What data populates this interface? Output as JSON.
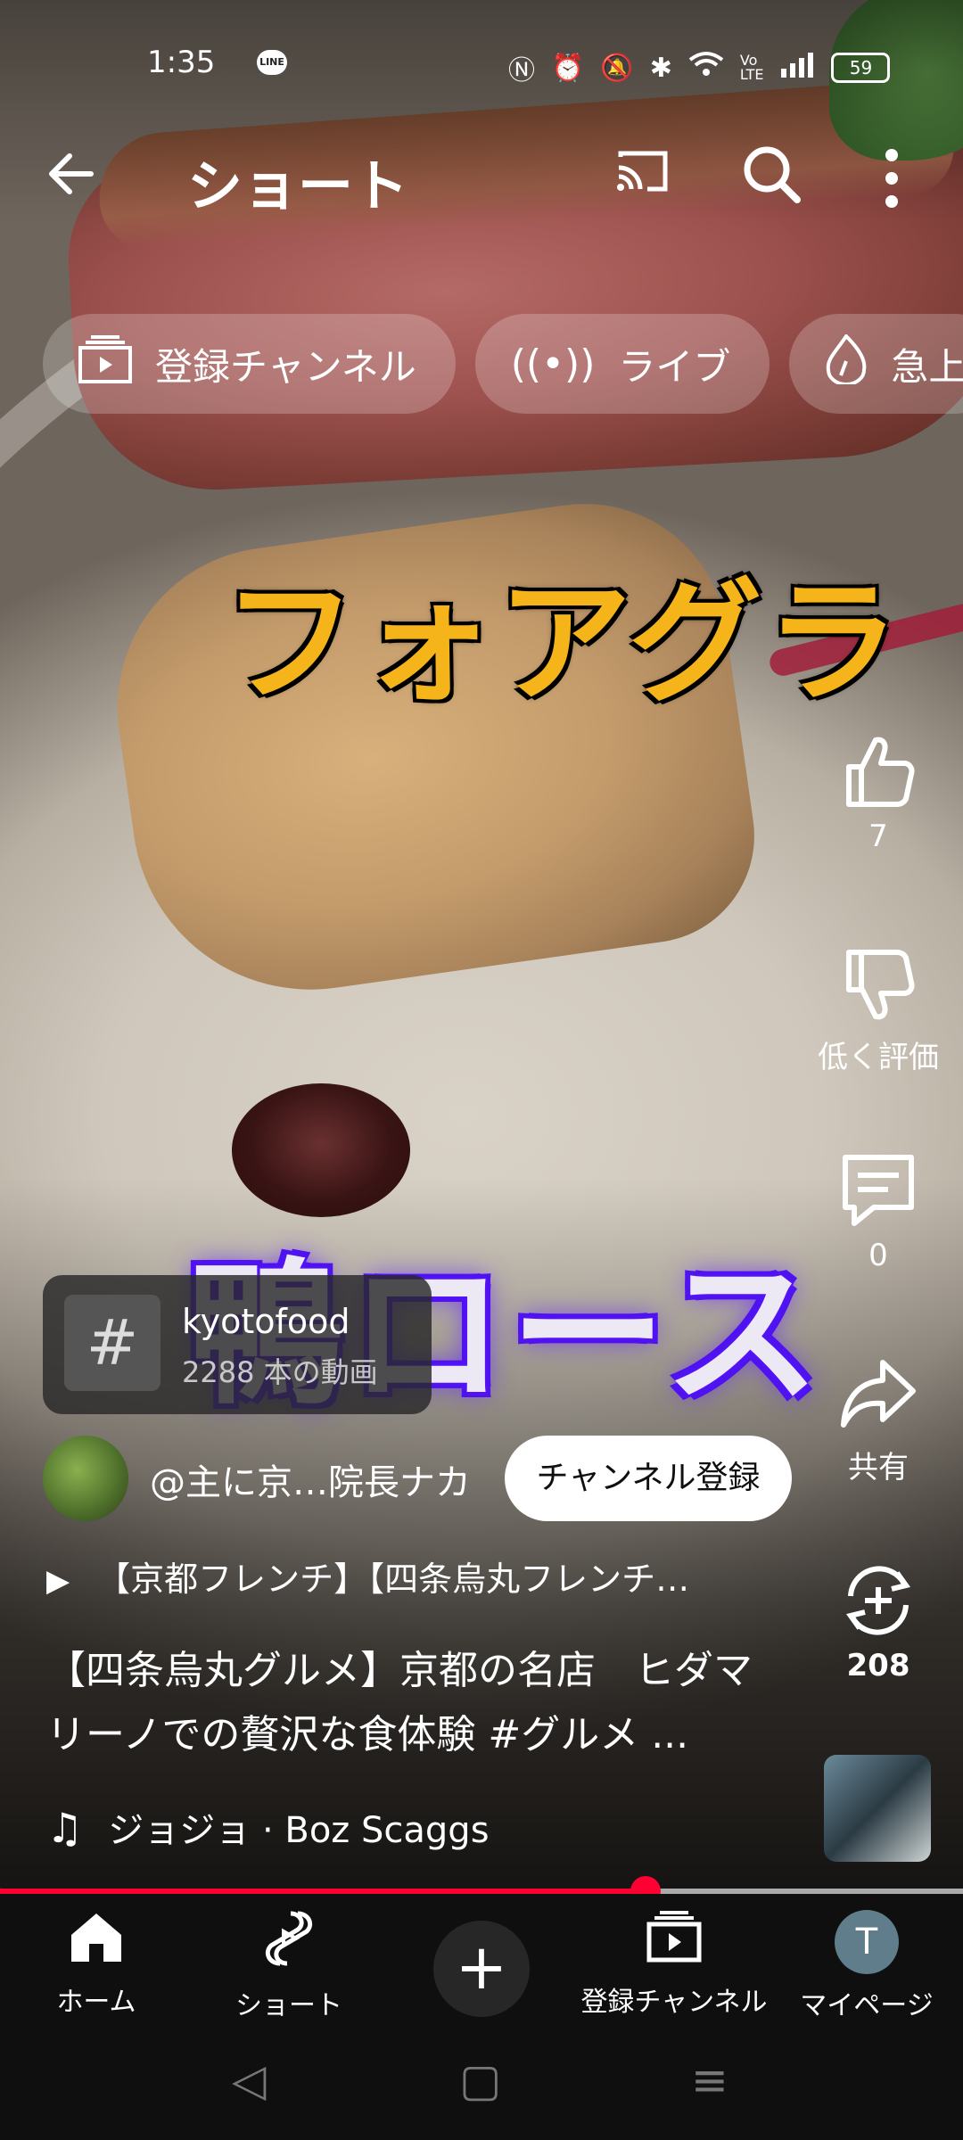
{
  "status_bar": {
    "time": "1:35",
    "line_label": "LINE",
    "battery": "59"
  },
  "app_bar": {
    "title": "ショート"
  },
  "chips": [
    {
      "icon": "subscriptions-icon",
      "label": "登録チャンネル"
    },
    {
      "icon": "live-icon",
      "label": "ライブ"
    },
    {
      "icon": "trending-icon",
      "label": "急上"
    }
  ],
  "video_captions": {
    "top": "フォアグラ",
    "bottom": "鴨ロース"
  },
  "actions": {
    "like_count": "7",
    "dislike_label": "低く評価",
    "comment_count": "0",
    "share_label": "共有",
    "remix_count": "208"
  },
  "hashtag": {
    "symbol": "#",
    "name": "kyotofood",
    "video_count": "2288 本の動画"
  },
  "channel": {
    "handle": "@主に京…院長ナカ",
    "subscribe_label": "チャンネル登録"
  },
  "playlist_title": "【京都フレンチ】【四条烏丸フレンチ…",
  "description": "【四条烏丸グルメ】京都の名店　ヒダマリーノでの贅沢な食体験 #グルメ ...",
  "music": "ジョジョ · Boz Scaggs",
  "progress": 0.67,
  "nav": {
    "home": "ホーム",
    "shorts": "ショート",
    "subscriptions": "登録チャンネル",
    "mypage": "マイページ",
    "avatar_letter": "T"
  },
  "colors": {
    "accent_red": "#ff0033",
    "caption_yellow": "#f4b41a",
    "caption_purple": "#4f13f0"
  }
}
